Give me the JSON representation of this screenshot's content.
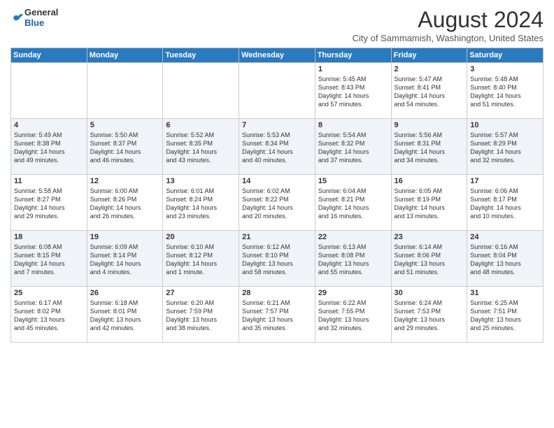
{
  "logo": {
    "general": "General",
    "blue": "Blue"
  },
  "header": {
    "title": "August 2024",
    "subtitle": "City of Sammamish, Washington, United States"
  },
  "days_of_week": [
    "Sunday",
    "Monday",
    "Tuesday",
    "Wednesday",
    "Thursday",
    "Friday",
    "Saturday"
  ],
  "weeks": [
    [
      {
        "day": "",
        "info": ""
      },
      {
        "day": "",
        "info": ""
      },
      {
        "day": "",
        "info": ""
      },
      {
        "day": "",
        "info": ""
      },
      {
        "day": "1",
        "info": "Sunrise: 5:45 AM\nSunset: 8:43 PM\nDaylight: 14 hours\nand 57 minutes."
      },
      {
        "day": "2",
        "info": "Sunrise: 5:47 AM\nSunset: 8:41 PM\nDaylight: 14 hours\nand 54 minutes."
      },
      {
        "day": "3",
        "info": "Sunrise: 5:48 AM\nSunset: 8:40 PM\nDaylight: 14 hours\nand 51 minutes."
      }
    ],
    [
      {
        "day": "4",
        "info": "Sunrise: 5:49 AM\nSunset: 8:38 PM\nDaylight: 14 hours\nand 49 minutes."
      },
      {
        "day": "5",
        "info": "Sunrise: 5:50 AM\nSunset: 8:37 PM\nDaylight: 14 hours\nand 46 minutes."
      },
      {
        "day": "6",
        "info": "Sunrise: 5:52 AM\nSunset: 8:35 PM\nDaylight: 14 hours\nand 43 minutes."
      },
      {
        "day": "7",
        "info": "Sunrise: 5:53 AM\nSunset: 8:34 PM\nDaylight: 14 hours\nand 40 minutes."
      },
      {
        "day": "8",
        "info": "Sunrise: 5:54 AM\nSunset: 8:32 PM\nDaylight: 14 hours\nand 37 minutes."
      },
      {
        "day": "9",
        "info": "Sunrise: 5:56 AM\nSunset: 8:31 PM\nDaylight: 14 hours\nand 34 minutes."
      },
      {
        "day": "10",
        "info": "Sunrise: 5:57 AM\nSunset: 8:29 PM\nDaylight: 14 hours\nand 32 minutes."
      }
    ],
    [
      {
        "day": "11",
        "info": "Sunrise: 5:58 AM\nSunset: 8:27 PM\nDaylight: 14 hours\nand 29 minutes."
      },
      {
        "day": "12",
        "info": "Sunrise: 6:00 AM\nSunset: 8:26 PM\nDaylight: 14 hours\nand 26 minutes."
      },
      {
        "day": "13",
        "info": "Sunrise: 6:01 AM\nSunset: 8:24 PM\nDaylight: 14 hours\nand 23 minutes."
      },
      {
        "day": "14",
        "info": "Sunrise: 6:02 AM\nSunset: 8:22 PM\nDaylight: 14 hours\nand 20 minutes."
      },
      {
        "day": "15",
        "info": "Sunrise: 6:04 AM\nSunset: 8:21 PM\nDaylight: 14 hours\nand 16 minutes."
      },
      {
        "day": "16",
        "info": "Sunrise: 6:05 AM\nSunset: 8:19 PM\nDaylight: 14 hours\nand 13 minutes."
      },
      {
        "day": "17",
        "info": "Sunrise: 6:06 AM\nSunset: 8:17 PM\nDaylight: 14 hours\nand 10 minutes."
      }
    ],
    [
      {
        "day": "18",
        "info": "Sunrise: 6:08 AM\nSunset: 8:15 PM\nDaylight: 14 hours\nand 7 minutes."
      },
      {
        "day": "19",
        "info": "Sunrise: 6:09 AM\nSunset: 8:14 PM\nDaylight: 14 hours\nand 4 minutes."
      },
      {
        "day": "20",
        "info": "Sunrise: 6:10 AM\nSunset: 8:12 PM\nDaylight: 14 hours\nand 1 minute."
      },
      {
        "day": "21",
        "info": "Sunrise: 6:12 AM\nSunset: 8:10 PM\nDaylight: 13 hours\nand 58 minutes."
      },
      {
        "day": "22",
        "info": "Sunrise: 6:13 AM\nSunset: 8:08 PM\nDaylight: 13 hours\nand 55 minutes."
      },
      {
        "day": "23",
        "info": "Sunrise: 6:14 AM\nSunset: 8:06 PM\nDaylight: 13 hours\nand 51 minutes."
      },
      {
        "day": "24",
        "info": "Sunrise: 6:16 AM\nSunset: 8:04 PM\nDaylight: 13 hours\nand 48 minutes."
      }
    ],
    [
      {
        "day": "25",
        "info": "Sunrise: 6:17 AM\nSunset: 8:02 PM\nDaylight: 13 hours\nand 45 minutes."
      },
      {
        "day": "26",
        "info": "Sunrise: 6:18 AM\nSunset: 8:01 PM\nDaylight: 13 hours\nand 42 minutes."
      },
      {
        "day": "27",
        "info": "Sunrise: 6:20 AM\nSunset: 7:59 PM\nDaylight: 13 hours\nand 38 minutes."
      },
      {
        "day": "28",
        "info": "Sunrise: 6:21 AM\nSunset: 7:57 PM\nDaylight: 13 hours\nand 35 minutes."
      },
      {
        "day": "29",
        "info": "Sunrise: 6:22 AM\nSunset: 7:55 PM\nDaylight: 13 hours\nand 32 minutes."
      },
      {
        "day": "30",
        "info": "Sunrise: 6:24 AM\nSunset: 7:53 PM\nDaylight: 13 hours\nand 29 minutes."
      },
      {
        "day": "31",
        "info": "Sunrise: 6:25 AM\nSunset: 7:51 PM\nDaylight: 13 hours\nand 25 minutes."
      }
    ]
  ]
}
